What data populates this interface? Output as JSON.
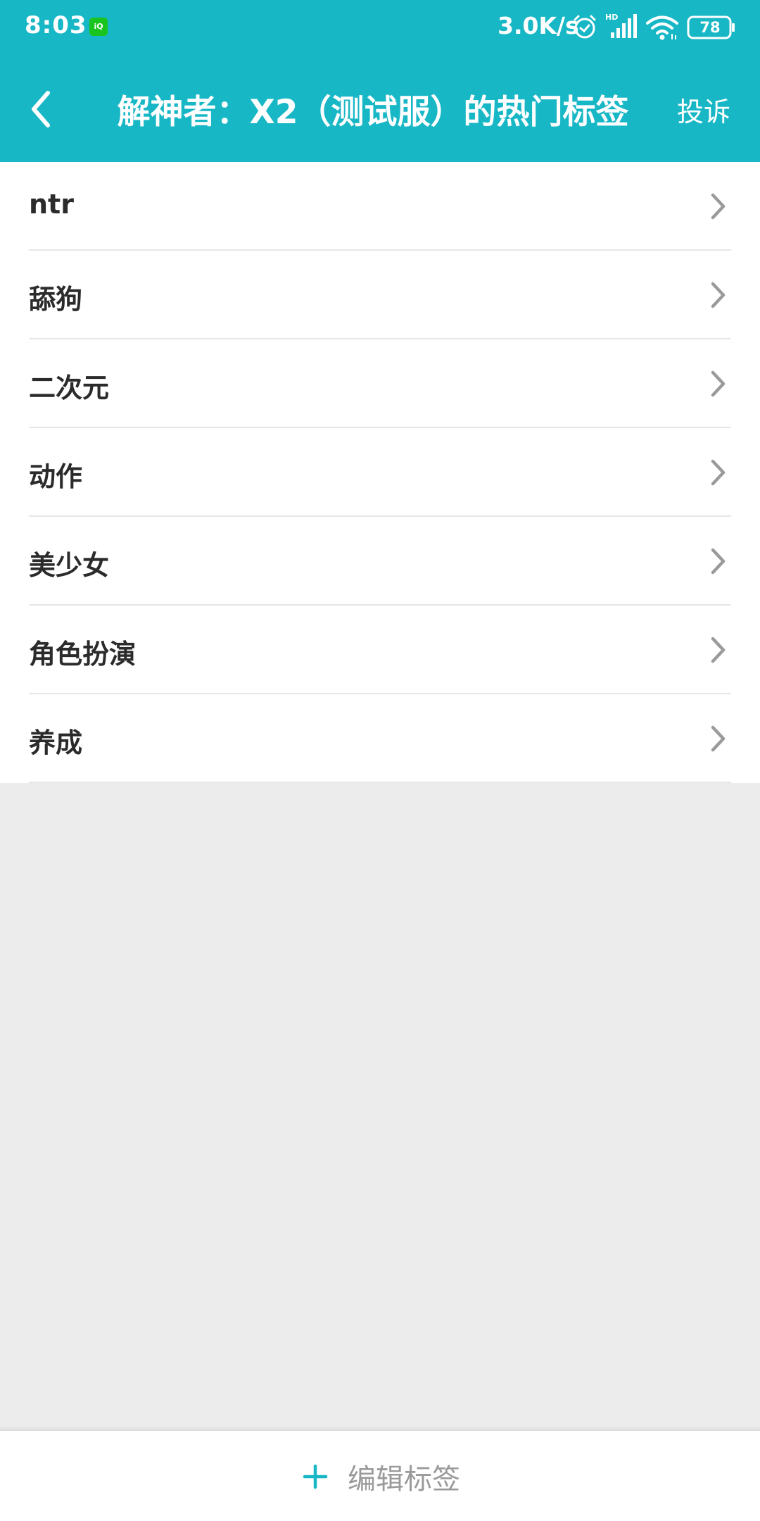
{
  "status_bar": {
    "time": "8:03",
    "app_notification_icon": "iqiyi-icon",
    "network_speed": "3.0K/s",
    "icons": [
      "alarm-icon",
      "hd-signal-icon",
      "wifi-icon",
      "battery-icon"
    ],
    "battery_level": "78"
  },
  "title_bar": {
    "back_icon": "back-arrow-icon",
    "title": "解神者：X2（测试服）的热门标签",
    "report_label": "投诉"
  },
  "tags": [
    {
      "label": "ntr"
    },
    {
      "label": "舔狗"
    },
    {
      "label": "二次元"
    },
    {
      "label": "动作"
    },
    {
      "label": "美少女"
    },
    {
      "label": "角色扮演"
    },
    {
      "label": "养成"
    }
  ],
  "bottom_bar": {
    "edit_icon": "plus-icon",
    "edit_label": "编辑标签"
  },
  "colors": {
    "accent": "#17b7c6",
    "background": "#ececec",
    "row_background": "#ffffff",
    "tag_text": "#2b2b2b",
    "chevron": "#9a9a9a",
    "edit_label": "#9a9a9a"
  }
}
